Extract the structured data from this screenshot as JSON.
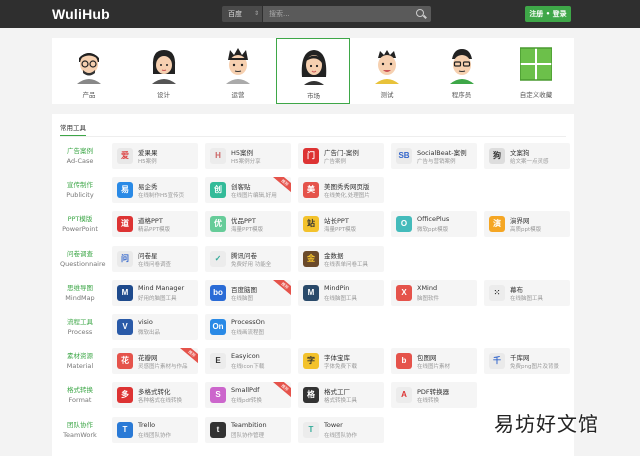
{
  "header": {
    "logo_wuli": "Wuli",
    "logo_hub": "Hub",
    "search_engine": "百度",
    "search_placeholder": "搜索...",
    "login_label": "注册 • 登录"
  },
  "categories": [
    {
      "label": "产品",
      "face": "glasses-man"
    },
    {
      "label": "设计",
      "face": "ponytail-woman"
    },
    {
      "label": "运营",
      "face": "spiky-man"
    },
    {
      "label": "市场",
      "face": "long-hair-woman",
      "active": true
    },
    {
      "label": "测试",
      "face": "bald-man"
    },
    {
      "label": "程序员",
      "face": "glasses-man-2"
    },
    {
      "label": "自定义收藏",
      "face": "grid-icon"
    }
  ],
  "tools": {
    "tab_title": "常用工具",
    "rows": [
      {
        "cn": "广告案例",
        "en": "Ad-Case",
        "tiles": [
          {
            "name": "爱果果",
            "desc": "H5案例",
            "icon": "爱",
            "color": "#e8e8e8",
            "fg": "#d44"
          },
          {
            "name": "H5案例",
            "desc": "H5案例分享",
            "icon": "H",
            "color": "#ececec",
            "fg": "#c66"
          },
          {
            "name": "广告门-案例",
            "desc": "广告案例",
            "icon": "门",
            "color": "#d33",
            "fg": "#fff"
          },
          {
            "name": "SocialBeat-案例",
            "desc": "广告与营销案例",
            "icon": "SB",
            "color": "#eaeaea",
            "fg": "#36c"
          },
          {
            "name": "文案狗",
            "desc": "给文案一点灵感",
            "icon": "狗",
            "color": "#ddd",
            "fg": "#333"
          }
        ]
      },
      {
        "cn": "宣传制作",
        "en": "Publicity",
        "tiles": [
          {
            "name": "易企秀",
            "desc": "在线制作H5宣传页",
            "icon": "易",
            "color": "#2a8ae6",
            "fg": "#fff"
          },
          {
            "name": "创客贴",
            "desc": "在线图片编辑,好用",
            "icon": "创",
            "color": "#3b9",
            "fg": "#fff",
            "ribbon": "推荐"
          },
          {
            "name": "美图秀秀网页版",
            "desc": "在线美化,处理图片",
            "icon": "美",
            "color": "#e5534b",
            "fg": "#fff"
          }
        ]
      },
      {
        "cn": "PPT模版",
        "en": "PowerPoint",
        "tiles": [
          {
            "name": "道格PPT",
            "desc": "精品PPT模版",
            "icon": "道",
            "color": "#d33",
            "fg": "#fff"
          },
          {
            "name": "优品PPT",
            "desc": "海量PPT模版",
            "icon": "优",
            "color": "#6c9",
            "fg": "#fff"
          },
          {
            "name": "站长PPT",
            "desc": "海量PPT模版",
            "icon": "站",
            "color": "#f3c22c",
            "fg": "#333"
          },
          {
            "name": "OfficePlus",
            "desc": "微软ppt模版",
            "icon": "O",
            "color": "#4bb",
            "fg": "#fff"
          },
          {
            "name": "演界网",
            "desc": "高质ppt模版",
            "icon": "演",
            "color": "#f5a623",
            "fg": "#fff"
          }
        ]
      },
      {
        "cn": "问卷调查",
        "en": "Questionnaire",
        "tiles": [
          {
            "name": "问卷星",
            "desc": "在线问卷调查",
            "icon": "问",
            "color": "#eaeaea",
            "fg": "#36c"
          },
          {
            "name": "腾讯问卷",
            "desc": "免费好用 功能全",
            "icon": "✓",
            "color": "#ececec",
            "fg": "#3a9"
          },
          {
            "name": "金数据",
            "desc": "在线表单问卷工具",
            "icon": "金",
            "color": "#6b4a2a",
            "fg": "#f3c22c"
          }
        ]
      },
      {
        "cn": "思维导图",
        "en": "MindMap",
        "tiles": [
          {
            "name": "Mind Manager",
            "desc": "好用的脑图工具",
            "icon": "M",
            "color": "#1e4a8c",
            "fg": "#fff"
          },
          {
            "name": "百度脑图",
            "desc": "在线脑图",
            "icon": "bo",
            "color": "#2a6bd6",
            "fg": "#fff",
            "ribbon": "推荐"
          },
          {
            "name": "MindPin",
            "desc": "在线脑图工具",
            "icon": "M",
            "color": "#2a4a6a",
            "fg": "#fff"
          },
          {
            "name": "XMind",
            "desc": "脑图软件",
            "icon": "X",
            "color": "#e5534b",
            "fg": "#fff"
          },
          {
            "name": "幕布",
            "desc": "在线脑图工具",
            "icon": "⁙",
            "color": "#ececec",
            "fg": "#333"
          }
        ]
      },
      {
        "cn": "流程工具",
        "en": "Process",
        "tiles": [
          {
            "name": "visio",
            "desc": "微软出品",
            "icon": "V",
            "color": "#2a5aa8",
            "fg": "#fff"
          },
          {
            "name": "ProcessOn",
            "desc": "在线画流程图",
            "icon": "On",
            "color": "#2a8ae6",
            "fg": "#fff"
          }
        ]
      },
      {
        "cn": "素材资源",
        "en": "Material",
        "tiles": [
          {
            "name": "花瓣网",
            "desc": "灵感图片素材与作品",
            "icon": "花",
            "color": "#e5534b",
            "fg": "#fff",
            "ribbon": "推荐"
          },
          {
            "name": "Easyicon",
            "desc": "在线icon下载",
            "icon": "E",
            "color": "#ececec",
            "fg": "#333"
          },
          {
            "name": "字体宝库",
            "desc": "字体免费下载",
            "icon": "字",
            "color": "#f3c22c",
            "fg": "#333"
          },
          {
            "name": "包图网",
            "desc": "在线图片素材",
            "icon": "b",
            "color": "#e5534b",
            "fg": "#fff"
          },
          {
            "name": "千库网",
            "desc": "免费png图片及背景",
            "icon": "千",
            "color": "#eaeaea",
            "fg": "#36c"
          }
        ]
      },
      {
        "cn": "格式转换",
        "en": "Format",
        "tiles": [
          {
            "name": "多格式转化",
            "desc": "各种格式在线转换",
            "icon": "多",
            "color": "#d33",
            "fg": "#fff"
          },
          {
            "name": "SmallPdf",
            "desc": "在线pdf转换",
            "icon": "S",
            "color": "#c6c",
            "fg": "#fff",
            "ribbon": "推荐"
          },
          {
            "name": "格式工厂",
            "desc": "格式转换工具",
            "icon": "格",
            "color": "#333",
            "fg": "#fff"
          },
          {
            "name": "PDF转换器",
            "desc": "在线转换",
            "icon": "A",
            "color": "#ececec",
            "fg": "#d33"
          }
        ]
      },
      {
        "cn": "团队协作",
        "en": "TeamWork",
        "tiles": [
          {
            "name": "Trello",
            "desc": "在线团队协作",
            "icon": "T",
            "color": "#2a7ad6",
            "fg": "#fff"
          },
          {
            "name": "Teambition",
            "desc": "团队协作管理",
            "icon": "t",
            "color": "#333",
            "fg": "#fff"
          },
          {
            "name": "Tower",
            "desc": "在线团队协作",
            "icon": "T",
            "color": "#ececec",
            "fg": "#3a9"
          }
        ]
      }
    ]
  },
  "watermark": "易坊好文馆"
}
